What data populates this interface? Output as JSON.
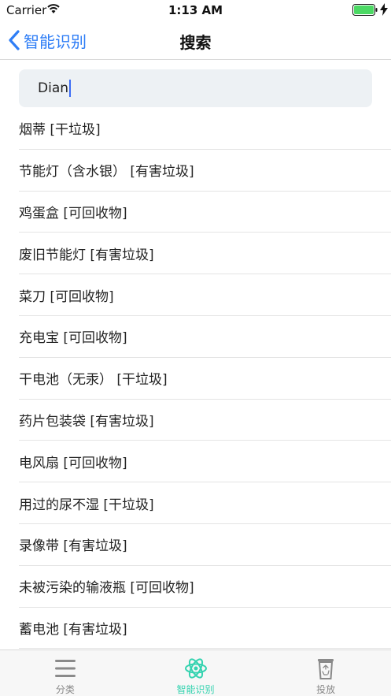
{
  "status_bar": {
    "carrier": "Carrier",
    "time": "1:13 AM"
  },
  "nav": {
    "back_label": "智能识别",
    "title": "搜索"
  },
  "search": {
    "value": "Dian"
  },
  "results": [
    "烟蒂 [干垃圾]",
    "节能灯（含水银） [有害垃圾]",
    "鸡蛋盒 [可回收物]",
    "废旧节能灯 [有害垃圾]",
    "菜刀 [可回收物]",
    "充电宝 [可回收物]",
    "干电池（无汞） [干垃圾]",
    "药片包装袋 [有害垃圾]",
    "电风扇 [可回收物]",
    "用过的尿不湿 [干垃圾]",
    "录像带 [有害垃圾]",
    "未被污染的输液瓶 [可回收物]",
    "蓄电池 [有害垃圾]"
  ],
  "tabs": [
    {
      "label": "分类",
      "icon": "menu-icon"
    },
    {
      "label": "智能识别",
      "icon": "atom-icon",
      "active": true
    },
    {
      "label": "投放",
      "icon": "recycle-bin-icon"
    }
  ],
  "colors": {
    "accent_blue": "#2f7ef6",
    "tab_active": "#35d3b0",
    "tab_inactive": "#888888",
    "battery_green": "#4cd964"
  }
}
